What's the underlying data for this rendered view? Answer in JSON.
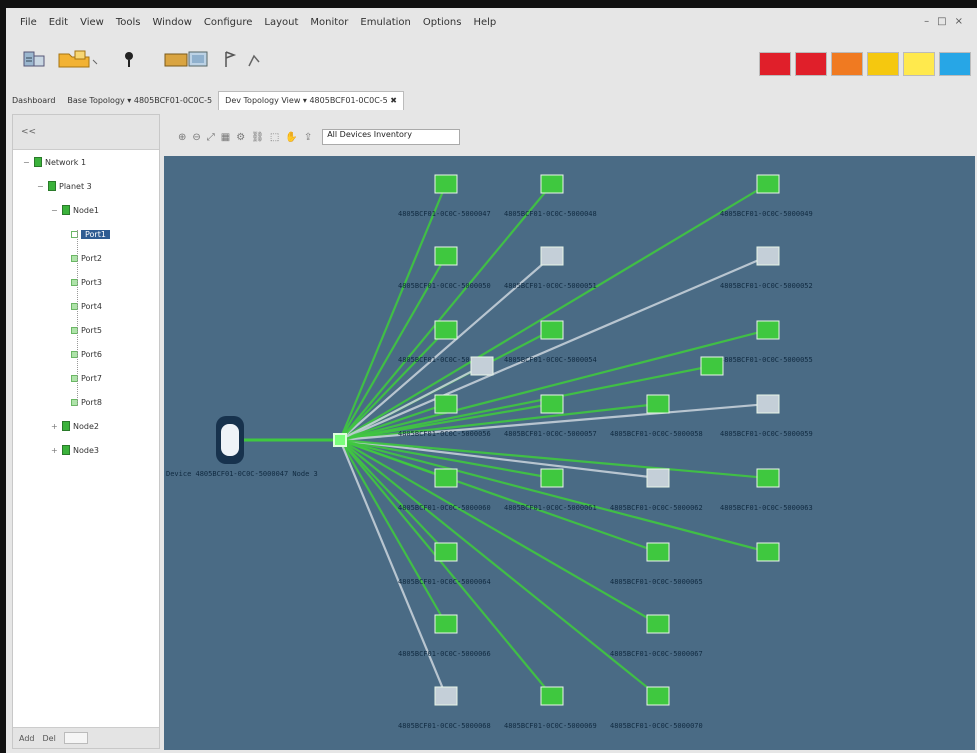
{
  "menu": {
    "items": [
      "File",
      "Edit",
      "View",
      "Tools",
      "Window",
      "Configure",
      "Layout",
      "Monitor",
      "Emulation",
      "Options",
      "Help"
    ]
  },
  "window_controls": [
    "–",
    "□",
    "×"
  ],
  "toolbar": {
    "buttons": [
      {
        "name": "new-project-icon"
      },
      {
        "name": "open-folder-icon"
      },
      {
        "name": "marker-icon"
      },
      {
        "name": "camera-icon"
      },
      {
        "name": "overview-icon"
      },
      {
        "name": "flag-icon"
      },
      {
        "name": "route-icon"
      }
    ],
    "status_colors": [
      "#e01f2a",
      "#e01f2a",
      "#f07a21",
      "#f5c80f",
      "#ffe94d",
      "#27a6e6"
    ]
  },
  "tabs": [
    {
      "label": "Dashboard",
      "active": false
    },
    {
      "label": "Base Topology ▾ 4805BCF01-0C0C-5",
      "active": false
    },
    {
      "label": "Dev Topology View ▾ 4805BCF01-0C0C-5 ✖",
      "active": true
    }
  ],
  "sidebar": {
    "header": "<<",
    "tree": [
      {
        "label": "Network 1",
        "level": 0,
        "kind": "network",
        "toggle": "−"
      },
      {
        "label": "Planet 3",
        "level": 1,
        "kind": "network",
        "toggle": "−"
      },
      {
        "label": "Node1",
        "level": 2,
        "kind": "network",
        "toggle": "−"
      },
      {
        "label": "Port1",
        "level": 3,
        "kind": "port",
        "selected": true
      },
      {
        "label": "Port2",
        "level": 3,
        "kind": "port"
      },
      {
        "label": "Port3",
        "level": 3,
        "kind": "port"
      },
      {
        "label": "Port4",
        "level": 3,
        "kind": "port"
      },
      {
        "label": "Port5",
        "level": 3,
        "kind": "port"
      },
      {
        "label": "Port6",
        "level": 3,
        "kind": "port"
      },
      {
        "label": "Port7",
        "level": 3,
        "kind": "port"
      },
      {
        "label": "Port8",
        "level": 3,
        "kind": "port"
      },
      {
        "label": "Node2",
        "level": 2,
        "kind": "network",
        "toggle": "+"
      },
      {
        "label": "Node3",
        "level": 2,
        "kind": "network",
        "toggle": "+"
      }
    ],
    "footer": [
      "Add",
      "Del"
    ]
  },
  "canvas_toolbar": {
    "icons": [
      "zoom-in-icon",
      "zoom-out-icon",
      "fit-icon",
      "grid-icon",
      "layout-icon",
      "link-icon",
      "select-icon",
      "pan-icon",
      "export-icon"
    ],
    "filter_value": "All Devices Inventory"
  },
  "graph": {
    "colors": {
      "up": "#3fc83f",
      "down": "#c4cfd8",
      "hub": "#7aff7a",
      "device": "#eef3f8"
    },
    "device": {
      "label": "Device 4805BCF01-0C0C-5000047  Node 3"
    },
    "hub_label": "",
    "nodes": [
      {
        "id": "n1",
        "status": "up",
        "label": "4805BCF01-0C0C-5000047"
      },
      {
        "id": "n2",
        "status": "up",
        "label": "4805BCF01-0C0C-5000048"
      },
      {
        "id": "n3",
        "status": "up",
        "label": "4805BCF01-0C0C-5000049"
      },
      {
        "id": "n4",
        "status": "up",
        "label": "4805BCF01-0C0C-5000050"
      },
      {
        "id": "n5",
        "status": "down",
        "label": "4805BCF01-0C0C-5000051"
      },
      {
        "id": "n6",
        "status": "down",
        "label": "4805BCF01-0C0C-5000052"
      },
      {
        "id": "n7",
        "status": "up",
        "label": "4805BCF01-0C0C-5000053"
      },
      {
        "id": "n8",
        "status": "up",
        "label": "4805BCF01-0C0C-5000054"
      },
      {
        "id": "n9",
        "status": "up",
        "label": "4805BCF01-0C0C-5000055"
      },
      {
        "id": "n10",
        "status": "up",
        "label": "4805BCF01-0C0C-5000056"
      },
      {
        "id": "n11",
        "status": "up",
        "label": "4805BCF01-0C0C-5000057"
      },
      {
        "id": "n12",
        "status": "up",
        "label": "4805BCF01-0C0C-5000058"
      },
      {
        "id": "n13",
        "status": "down",
        "label": "4805BCF01-0C0C-5000059"
      },
      {
        "id": "n14",
        "status": "up",
        "label": "4805BCF01-0C0C-5000060"
      },
      {
        "id": "n15",
        "status": "up",
        "label": "4805BCF01-0C0C-5000061"
      },
      {
        "id": "n16",
        "status": "down",
        "label": "4805BCF01-0C0C-5000062"
      },
      {
        "id": "n17",
        "status": "up",
        "label": "4805BCF01-0C0C-5000063"
      },
      {
        "id": "n18",
        "status": "up",
        "label": "4805BCF01-0C0C-5000064"
      },
      {
        "id": "n19",
        "status": "up",
        "label": "4805BCF01-0C0C-5000065"
      },
      {
        "id": "n20",
        "status": "up",
        "label": "4805BCF01-0C0C-5000066"
      },
      {
        "id": "n21",
        "status": "up",
        "label": "4805BCF01-0C0C-5000067"
      },
      {
        "id": "n22",
        "status": "down",
        "label": "4805BCF01-0C0C-5000068"
      },
      {
        "id": "n23",
        "status": "up",
        "label": "4805BCF01-0C0C-5000069"
      },
      {
        "id": "n24",
        "status": "up",
        "label": "4805BCF01-0C0C-5000070"
      },
      {
        "id": "n25",
        "status": "down",
        "label": "4805BCF01-0C0C-5000071"
      },
      {
        "id": "n26",
        "status": "up",
        "label": "4805BCF01-0C0C-5000072"
      },
      {
        "id": "n27",
        "status": "up",
        "label": "4805BCF01-0C0C-5000073"
      }
    ]
  }
}
